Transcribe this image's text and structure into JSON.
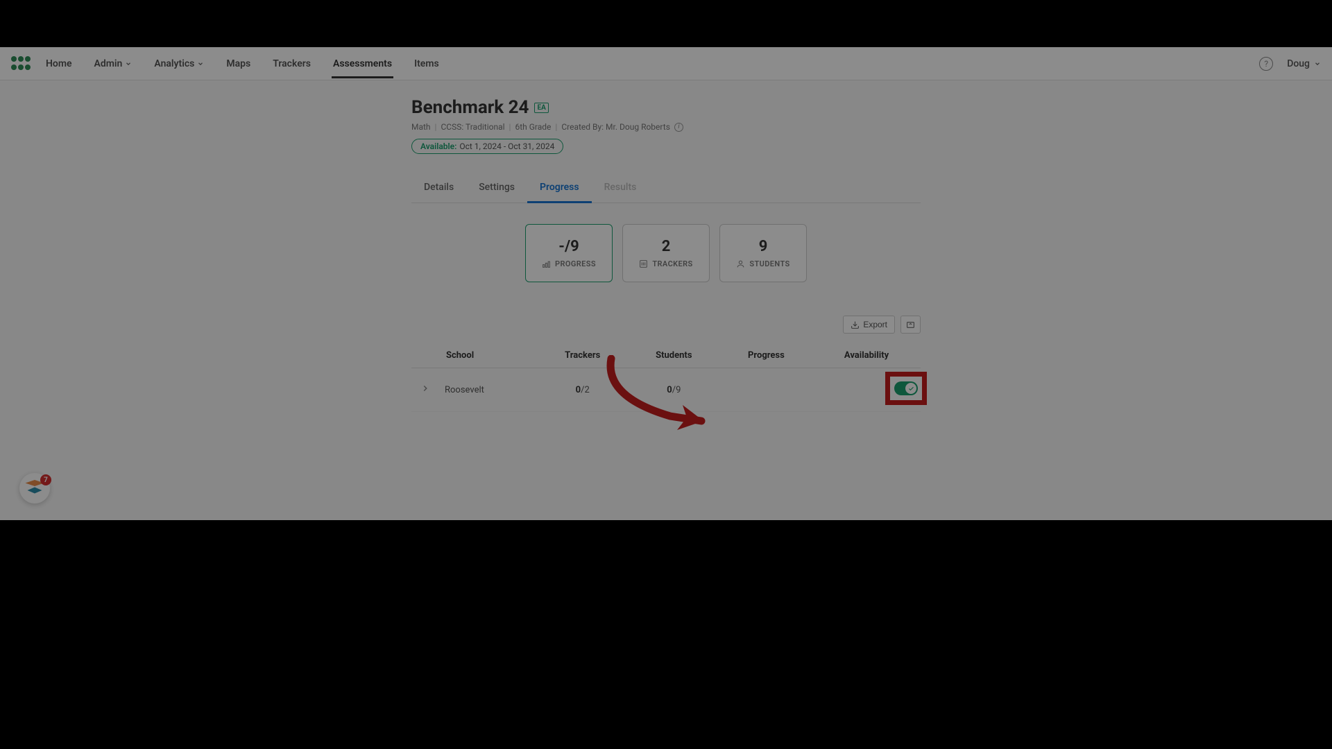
{
  "nav": {
    "items": [
      "Home",
      "Admin",
      "Analytics",
      "Maps",
      "Trackers",
      "Assessments",
      "Items"
    ],
    "active": "Assessments",
    "user": "Doug"
  },
  "header": {
    "title": "Benchmark 24",
    "badge": "EA",
    "meta": {
      "subject": "Math",
      "standard": "CCSS: Traditional",
      "grade": "6th Grade",
      "created_by": "Created By: Mr. Doug Roberts"
    },
    "availability": {
      "label": "Available:",
      "dates": "Oct 1, 2024 - Oct 31, 2024"
    }
  },
  "tabs": {
    "items": [
      "Details",
      "Settings",
      "Progress",
      "Results"
    ],
    "active": "Progress",
    "disabled": "Results"
  },
  "stats": {
    "progress": {
      "value": "-",
      "sub": "/9",
      "label": "PROGRESS"
    },
    "trackers": {
      "value": "2",
      "label": "TRACKERS"
    },
    "students": {
      "value": "9",
      "label": "STUDENTS"
    }
  },
  "toolbar": {
    "export_label": "Export"
  },
  "table": {
    "headers": {
      "school": "School",
      "trackers": "Trackers",
      "students": "Students",
      "progress": "Progress",
      "availability": "Availability"
    },
    "rows": [
      {
        "school": "Roosevelt",
        "trackers_done": "0",
        "trackers_total": "/2",
        "students_done": "0",
        "students_total": "/9"
      }
    ]
  },
  "widget": {
    "badge": "7"
  }
}
